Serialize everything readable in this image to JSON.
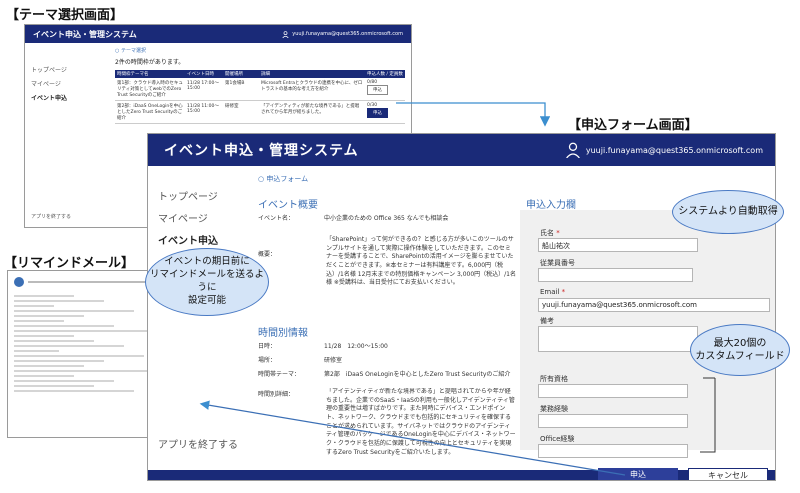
{
  "labels": {
    "theme_select": "【テーマ選択画面】",
    "form": "【申込フォーム画面】",
    "reminder": "【リマインドメール】"
  },
  "small_screen": {
    "title": "イベント申込・管理システム",
    "user_email": "yuuji.funayama@quest365.onmicrosoft.com",
    "side": [
      "トップページ",
      "マイページ",
      "イベント申込"
    ],
    "exit": "アプリを終了する",
    "crumb": "○ テーマ選択",
    "count_text": "2件の時間枠があります。",
    "columns": [
      "時間枠テーマ名",
      "イベント日時",
      "開催場所",
      "詳細",
      "申込人数 / 定員数"
    ],
    "rows": [
      {
        "theme": "第1部：クラウド導入時のセキュリティ対策としてwebでのZero Trust Securityのご紹介",
        "datetime": "11/28 17:00〜15:00",
        "place": "第1会場B",
        "detail": "Microsoft Entraとクラウドの連携を中心に、ゼロトラストの基本的な考え方を紹介",
        "count": "0/80",
        "button": "申込"
      },
      {
        "theme": "第2部：iDaaS OneLoginを中心としたZero Trust Securityのご紹介",
        "datetime": "11/28 11:00〜15:00",
        "place": "研修室",
        "detail": "「アイデンティティが新たな境界である」と提唱されてから年月が経ちました。",
        "count": "0/30",
        "button": "申込"
      }
    ]
  },
  "main_screen": {
    "title": "イベント申込・管理システム",
    "user_email": "yuuji.funayama@quest365.onmicrosoft.com",
    "side": [
      "トップページ",
      "マイページ",
      "イベント申込"
    ],
    "exit": "アプリを終了する",
    "crumb": "○ 申込フォーム",
    "event_overview": "イベント概要",
    "event_name_label": "イベント名：",
    "event_name": "中小企業のための Office 365 なんでも相談会",
    "overview_label": "概要：",
    "overview": "「SharePoint」って何ができるの？と感じる方が多いこのツールのサンプルサイトを通して実際に操作体験をしていただきます。このセミナーを受講することで、SharePointの活用イメージを膨らませていただくことができます。※本セミナーは有料講座です。6,000円（税込）/1名様 12月末までの特別価格キャンペーン 3,000円（税込）/1名様 ※受講料は、当日受付にてお支払いください。",
    "time_info": "時間別情報",
    "date_label": "日時：",
    "date": "11/28　12:00〜15:00",
    "place_label": "場所：",
    "place": "研修室",
    "slot_theme_label": "時間帯テーマ：",
    "slot_theme": "第2部　iDaaS OneLoginを中心としたZero Trust Securityのご紹介",
    "slot_detail_label": "時間別詳細：",
    "slot_detail": "「アイデンティティが新たな境界である」と提唱されてからや年が経ちました。企業でのSaaS・IaaSの利用も一般化しアイデンティティ管理の重要性は増すばかりです。また同時にデバイス・エンドポイント、ネットワーク、クラウドまでも包括的にセキュリティを確保することが求められています。サイバネットではクラウドのアイデンティティ管理のパッケージであるOneLoginを中心にデバイス・ネットワーク・クラウドを包括的に保護して可視性の向上とセキュリティを実現するZero Trust Securityをご紹介いたします。",
    "form_title": "申込入力欄",
    "name_label": "氏名",
    "name_value": "船山祐次",
    "employee_label": "従業員番号",
    "email_label": "Email",
    "email_value": "yuuji.funayama@quest365.onmicrosoft.com",
    "note_label": "備考",
    "custom_fields": [
      "所有資格",
      "業務経験",
      "Office経験"
    ],
    "apply_button": "申込",
    "cancel_button": "キャンセル",
    "required_mark": "*"
  },
  "callouts": {
    "auto": "システムより自動取得",
    "custom": "最大20個の\nカスタムフィールド",
    "remind": "イベントの期日前に\nリマインドメールを送るように\n設定可能"
  },
  "colors": {
    "header": "#1a2a78",
    "accent": "#3b6fb5",
    "callout_fill": "#d4e4f7",
    "callout_border": "#4a7ac4"
  }
}
